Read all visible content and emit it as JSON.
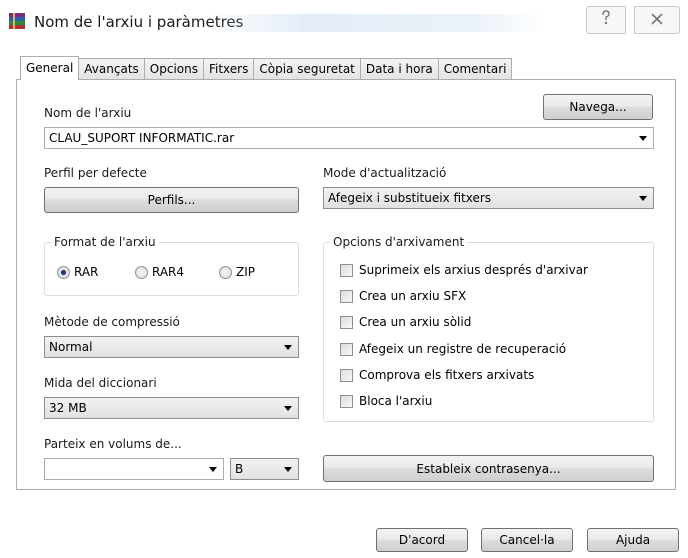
{
  "window": {
    "title": "Nom de l'arxiu i paràmetres",
    "help_icon": "help-icon",
    "close_icon": "close-icon"
  },
  "tabs": [
    {
      "label": "General",
      "active": true
    },
    {
      "label": "Avançats"
    },
    {
      "label": "Opcions"
    },
    {
      "label": "Fitxers"
    },
    {
      "label": "Còpia seguretat"
    },
    {
      "label": "Data i hora"
    },
    {
      "label": "Comentari"
    }
  ],
  "archive_name": {
    "label": "Nom de l'arxiu",
    "browse_button": "Navega...",
    "value": "CLAU_SUPORT INFORMATIC.rar"
  },
  "profile": {
    "label": "Perfil per defecte",
    "button": "Perfils..."
  },
  "update_mode": {
    "label": "Mode d'actualització",
    "value": "Afegeix i substitueix fitxers"
  },
  "archive_format": {
    "title": "Format de l'arxiu",
    "options": [
      {
        "label": "RAR",
        "selected": true
      },
      {
        "label": "RAR4",
        "selected": false
      },
      {
        "label": "ZIP",
        "selected": false
      }
    ]
  },
  "compression": {
    "label": "Mètode de compressió",
    "value": "Normal"
  },
  "dictionary": {
    "label": "Mida del diccionari",
    "value": "32 MB"
  },
  "volumes": {
    "label": "Parteix en volums de...",
    "value": "",
    "unit": "B"
  },
  "archiving_options": {
    "title": "Opcions d'arxivament",
    "items": [
      {
        "label": "Suprimeix els arxius després d'arxivar",
        "checked": false
      },
      {
        "label": "Crea un arxiu SFX",
        "checked": false
      },
      {
        "label": "Crea un arxiu sòlid",
        "checked": false
      },
      {
        "label": "Afegeix un registre de recuperació",
        "checked": false
      },
      {
        "label": "Comprova els fitxers arxivats",
        "checked": false
      },
      {
        "label": "Bloca l'arxiu",
        "checked": false
      }
    ]
  },
  "password_button": "Estableix contrasenya...",
  "footer": {
    "ok": "D'acord",
    "cancel": "Cancel·la",
    "help": "Ajuda"
  }
}
